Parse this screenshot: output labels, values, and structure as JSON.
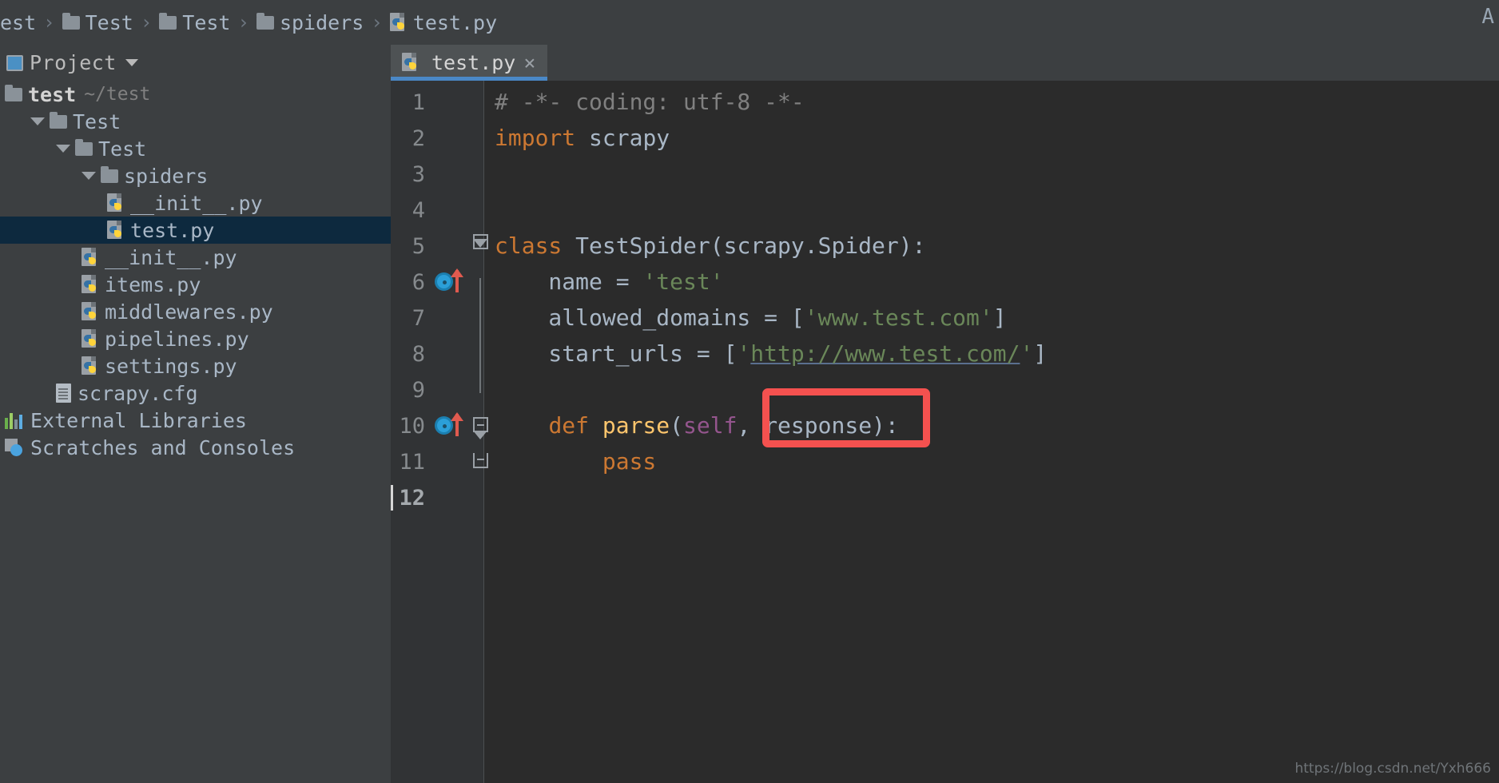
{
  "breadcrumb": {
    "items": [
      {
        "label": "est",
        "icon": "none"
      },
      {
        "label": "Test",
        "icon": "folder-icon"
      },
      {
        "label": "Test",
        "icon": "folder-icon"
      },
      {
        "label": "spiders",
        "icon": "folder-icon"
      },
      {
        "label": "test.py",
        "icon": "python-file-icon"
      }
    ],
    "separator": "›",
    "right_indicator": "A"
  },
  "project_panel": {
    "title": "Project",
    "dropdown_caret": "▾",
    "tools": [
      {
        "name": "locate-target-icon",
        "glyph": "⊕"
      },
      {
        "name": "collapse-all-icon",
        "glyph": "⇵"
      },
      {
        "name": "settings-gear-icon",
        "glyph": "⚙"
      },
      {
        "name": "hide-panel-icon",
        "glyph": "—"
      }
    ],
    "tree": [
      {
        "label": "test",
        "sub": "~/test",
        "indent": 0,
        "icon": "folder-icon",
        "arrow": false,
        "bold": true,
        "selected": false
      },
      {
        "label": "Test",
        "sub": "",
        "indent": 1,
        "icon": "folder-icon",
        "arrow": true,
        "bold": false,
        "selected": false
      },
      {
        "label": "Test",
        "sub": "",
        "indent": 2,
        "icon": "folder-icon",
        "arrow": true,
        "bold": false,
        "selected": false
      },
      {
        "label": "spiders",
        "sub": "",
        "indent": 3,
        "icon": "folder-icon",
        "arrow": true,
        "bold": false,
        "selected": false
      },
      {
        "label": "__init__.py",
        "sub": "",
        "indent": 4,
        "icon": "python-file-icon",
        "arrow": false,
        "bold": false,
        "selected": false
      },
      {
        "label": "test.py",
        "sub": "",
        "indent": 4,
        "icon": "python-file-icon",
        "arrow": false,
        "bold": false,
        "selected": true
      },
      {
        "label": "__init__.py",
        "sub": "",
        "indent": 3,
        "icon": "python-file-icon",
        "arrow": false,
        "bold": false,
        "selected": false
      },
      {
        "label": "items.py",
        "sub": "",
        "indent": 3,
        "icon": "python-file-icon",
        "arrow": false,
        "bold": false,
        "selected": false
      },
      {
        "label": "middlewares.py",
        "sub": "",
        "indent": 3,
        "icon": "python-file-icon",
        "arrow": false,
        "bold": false,
        "selected": false
      },
      {
        "label": "pipelines.py",
        "sub": "",
        "indent": 3,
        "icon": "python-file-icon",
        "arrow": false,
        "bold": false,
        "selected": false
      },
      {
        "label": "settings.py",
        "sub": "",
        "indent": 3,
        "icon": "python-file-icon",
        "arrow": false,
        "bold": false,
        "selected": false
      },
      {
        "label": "scrapy.cfg",
        "sub": "",
        "indent": 2,
        "icon": "config-file-icon",
        "arrow": false,
        "bold": false,
        "selected": false
      },
      {
        "label": "External Libraries",
        "sub": "",
        "indent": 0,
        "icon": "libraries-icon",
        "arrow": false,
        "bold": false,
        "selected": false
      },
      {
        "label": "Scratches and Consoles",
        "sub": "",
        "indent": 0,
        "icon": "scratches-icon",
        "arrow": false,
        "bold": false,
        "selected": false
      }
    ]
  },
  "editor": {
    "tab": {
      "label": "test.py",
      "close_glyph": "×",
      "icon": "python-file-icon",
      "active": true
    },
    "cursor_line": 12,
    "lines": [
      {
        "num": 1,
        "tokens": [
          {
            "t": "# -*- coding: utf-8 -*-",
            "c": "c-comment"
          }
        ]
      },
      {
        "num": 2,
        "tokens": [
          {
            "t": "import",
            "c": "c-kw"
          },
          {
            "t": " scrapy",
            "c": "c-ident"
          }
        ]
      },
      {
        "num": 3,
        "tokens": []
      },
      {
        "num": 4,
        "tokens": []
      },
      {
        "num": 5,
        "tokens": [
          {
            "t": "class",
            "c": "c-kw"
          },
          {
            "t": " TestSpider(scrapy.Spider):",
            "c": "c-ident"
          }
        ]
      },
      {
        "num": 6,
        "tokens": [
          {
            "t": "    name = ",
            "c": "c-ident"
          },
          {
            "t": "'test'",
            "c": "c-str"
          }
        ]
      },
      {
        "num": 7,
        "tokens": [
          {
            "t": "    allowed_domains = [",
            "c": "c-ident"
          },
          {
            "t": "'www.test.com'",
            "c": "c-str"
          },
          {
            "t": "]",
            "c": "c-ident"
          }
        ]
      },
      {
        "num": 8,
        "tokens": [
          {
            "t": "    start_urls = [",
            "c": "c-ident"
          },
          {
            "t": "'",
            "c": "c-str"
          },
          {
            "t": "http://www.test.com/",
            "c": "c-link"
          },
          {
            "t": "'",
            "c": "c-str"
          },
          {
            "t": "]",
            "c": "c-ident"
          }
        ]
      },
      {
        "num": 9,
        "tokens": []
      },
      {
        "num": 10,
        "tokens": [
          {
            "t": "    ",
            "c": "c-ident"
          },
          {
            "t": "def",
            "c": "c-kw"
          },
          {
            "t": " ",
            "c": "c-ident"
          },
          {
            "t": "parse",
            "c": "c-fn"
          },
          {
            "t": "(",
            "c": "c-ident"
          },
          {
            "t": "self",
            "c": "c-self"
          },
          {
            "t": ", ",
            "c": "c-ident"
          },
          {
            "t": "response",
            "c": "c-ident"
          },
          {
            "t": "):",
            "c": "c-ident"
          }
        ]
      },
      {
        "num": 11,
        "tokens": [
          {
            "t": "        ",
            "c": "c-ident"
          },
          {
            "t": "pass",
            "c": "c-kw"
          }
        ]
      },
      {
        "num": 12,
        "tokens": []
      }
    ],
    "gutter_markers": [
      {
        "line": 6,
        "icon": "override-method-icon"
      },
      {
        "line": 10,
        "icon": "override-method-icon"
      }
    ],
    "fold_markers": [
      {
        "line": 5,
        "icon": "fold-collapse-icon"
      },
      {
        "line": 10,
        "icon": "fold-collapse-icon"
      },
      {
        "line": 11,
        "icon": "fold-end-icon"
      }
    ],
    "annotation": {
      "label": "response-highlight-box",
      "color": "#f4514f",
      "target_text": "response)"
    }
  },
  "watermark": {
    "text": "https://blog.csdn.net/Yxh666"
  },
  "colors": {
    "panel_bg": "#3c3f41",
    "editor_bg": "#2b2b2b",
    "gutter_bg": "#313335",
    "selection": "#0d293e",
    "tab_active": "#4e5254",
    "tab_underline": "#4a88c7",
    "keyword": "#cc7832",
    "string": "#6a8759",
    "ident": "#a9b7c6",
    "fn": "#ffc66d",
    "self": "#94558d",
    "comment": "#808080",
    "annotation": "#f4514f"
  }
}
